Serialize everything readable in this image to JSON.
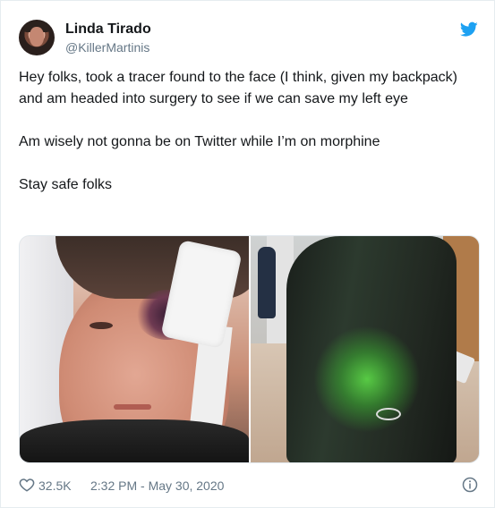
{
  "author": {
    "name": "Linda Tirado",
    "handle": "@KillerMartinis"
  },
  "tweet": {
    "paragraphs": [
      "Hey folks, took a tracer found to the face (I think, given my backpack) and am headed into surgery to see if we can save my left eye",
      "Am wisely not gonna be on Twitter while I’m on morphine",
      "Stay safe folks"
    ]
  },
  "media": [
    {
      "icon": "injured-face-photo"
    },
    {
      "icon": "backpack-photo"
    }
  ],
  "footer": {
    "like_count": "32.5K",
    "timestamp": "2:32 PM - May 30, 2020"
  },
  "colors": {
    "twitter_blue": "#1da1f2",
    "text_primary": "#14171a",
    "text_secondary": "#657786"
  }
}
